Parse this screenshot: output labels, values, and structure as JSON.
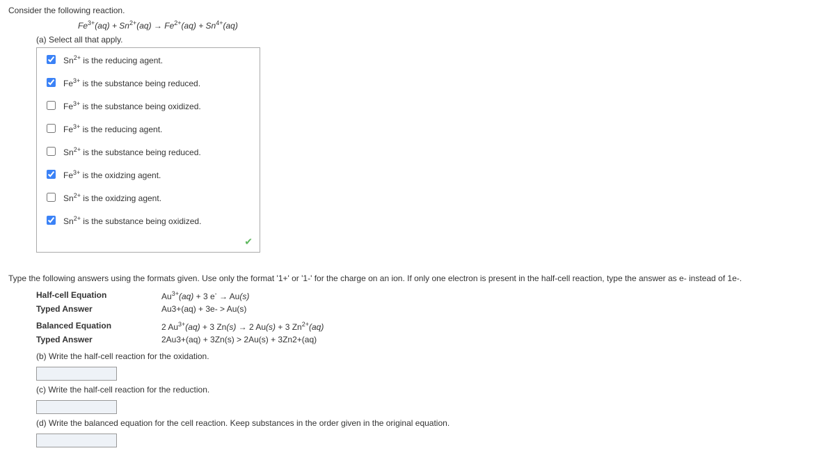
{
  "intro": "Consider the following reaction.",
  "reaction_html": "Fe<sup>3+</sup><i>(aq)</i> + Sn<sup>2+</sup><i>(aq)</i> → Fe<sup>2+</sup><i>(aq)</i> + Sn<sup>4+</sup><i>(aq)</i>",
  "part_a_label": "(a) Select all that apply.",
  "checkboxes": [
    {
      "checked": true,
      "label_html": "Sn<sup>2+</sup> is the reducing agent."
    },
    {
      "checked": true,
      "label_html": "Fe<sup>3+</sup> is the substance being reduced."
    },
    {
      "checked": false,
      "label_html": "Fe<sup>3+</sup> is the substance being oxidized."
    },
    {
      "checked": false,
      "label_html": "Fe<sup>3+</sup> is the reducing agent."
    },
    {
      "checked": false,
      "label_html": "Sn<sup>2+</sup> is the substance being reduced."
    },
    {
      "checked": true,
      "label_html": "Fe<sup>3+</sup> is the oxidzing agent."
    },
    {
      "checked": false,
      "label_html": "Sn<sup>2+</sup> is the oxidzing agent."
    },
    {
      "checked": true,
      "label_html": "Sn<sup>2+</sup> is the substance being oxidized."
    }
  ],
  "feedback_icon": "✔",
  "instructions": "Type the following answers using the formats given. Use only the format '1+' or '1-' for the charge on an ion. If only one electron is present in the half-cell reaction, type the answer as e- instead of 1e-.",
  "half_cell_label": "Half-cell Equation",
  "half_cell_eqn_html": "Au<sup>3+</sup><i>(aq)</i> + 3 e<sup>-</sup> → Au<i>(s)</i>",
  "typed_answer_label": "Typed Answer",
  "half_cell_typed": "Au3+(aq) + 3e- > Au(s)",
  "balanced_label": "Balanced Equation",
  "balanced_eqn_html": "2 Au<sup>3+</sup><i>(aq)</i> + 3 Zn<i>(s)</i> → 2 Au<i>(s)</i> + 3 Zn<sup>2+</sup><i>(aq)</i>",
  "balanced_typed": "2Au3+(aq) + 3Zn(s) > 2Au(s) + 3Zn2+(aq)",
  "question_b": "(b) Write the half-cell reaction for the oxidation.",
  "question_c": "(c) Write the half-cell reaction for the reduction.",
  "question_d": "(d) Write the balanced equation for the cell reaction. Keep substances in the order given in the original equation."
}
